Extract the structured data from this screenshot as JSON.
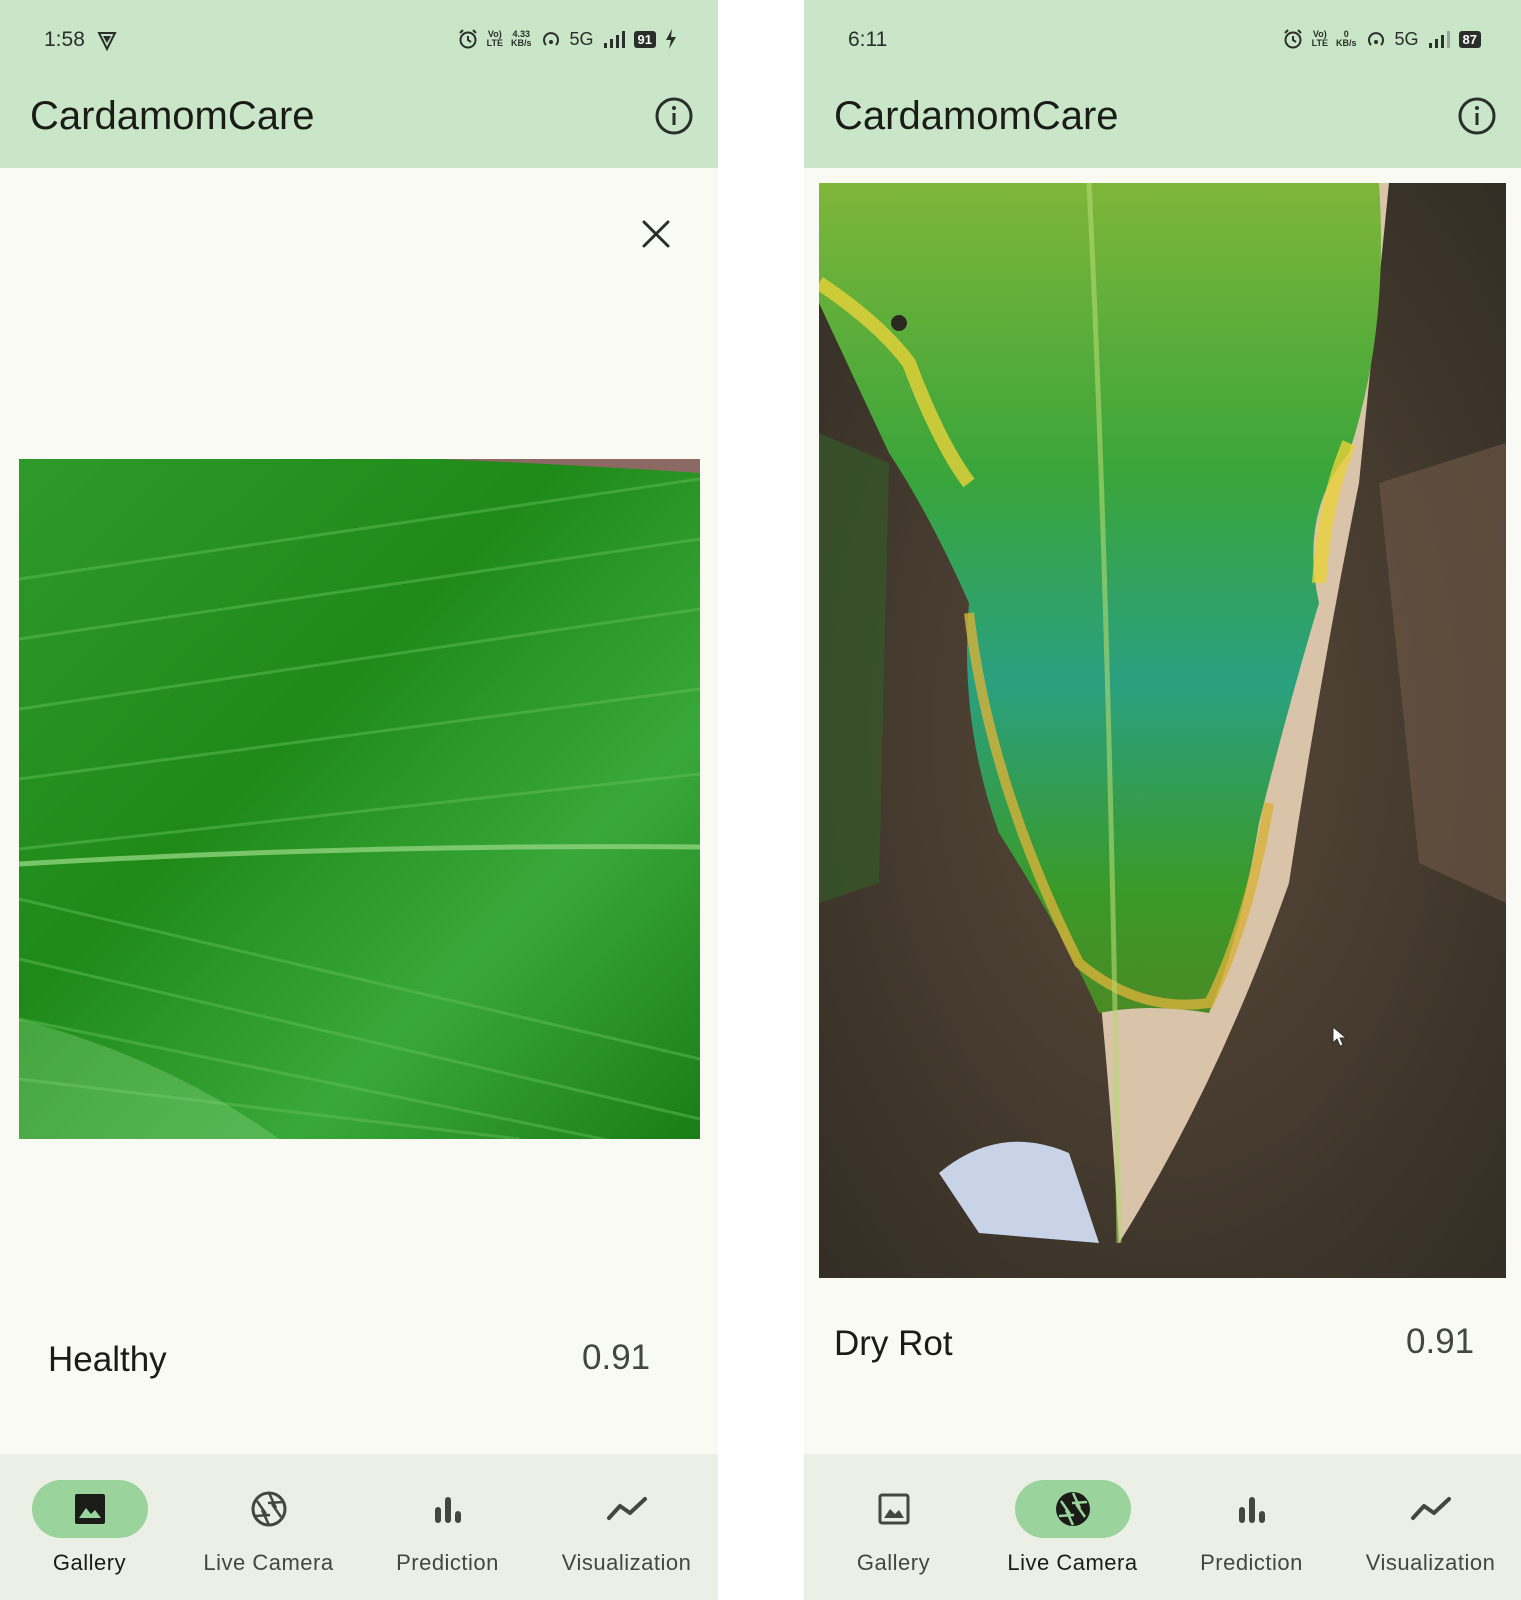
{
  "left_screen": {
    "status": {
      "time": "1:58",
      "net_speed_top": "4.33",
      "net_speed_bottom": "KB/s",
      "network": "5G",
      "battery": "91",
      "volte_top": "Vo)",
      "volte_bottom": "LTE"
    },
    "app_title": "CardamomCare",
    "result": {
      "label": "Healthy",
      "score": "0.91"
    },
    "nav": [
      {
        "label": "Gallery",
        "icon": "gallery-icon",
        "active": true
      },
      {
        "label": "Live Camera",
        "icon": "camera-shutter-icon",
        "active": false
      },
      {
        "label": "Prediction",
        "icon": "bar-chart-icon",
        "active": false
      },
      {
        "label": "Visualization",
        "icon": "line-chart-icon",
        "active": false
      }
    ]
  },
  "right_screen": {
    "status": {
      "time": "6:11",
      "net_speed_top": "0",
      "net_speed_bottom": "KB/s",
      "network": "5G",
      "battery": "87",
      "volte_top": "Vo)",
      "volte_bottom": "LTE"
    },
    "app_title": "CardamomCare",
    "result": {
      "label": "Dry Rot",
      "score": "0.91"
    },
    "nav": [
      {
        "label": "Gallery",
        "icon": "gallery-icon",
        "active": false
      },
      {
        "label": "Live Camera",
        "icon": "camera-shutter-icon",
        "active": true
      },
      {
        "label": "Prediction",
        "icon": "bar-chart-icon",
        "active": false
      },
      {
        "label": "Visualization",
        "icon": "line-chart-icon",
        "active": false
      }
    ]
  },
  "colors": {
    "app_bar": "#c9e6c9",
    "active_pill": "#9ad39b",
    "background": "#f8faf3",
    "nav_bar": "#ecefe6"
  }
}
